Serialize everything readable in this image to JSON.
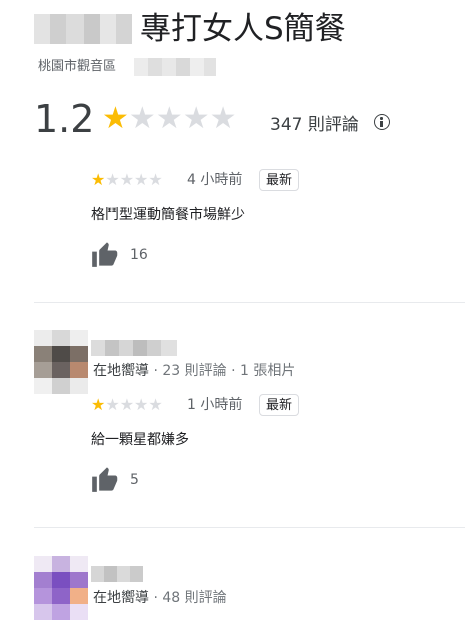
{
  "place": {
    "title": "專打女人S簡餐",
    "address": "桃園市觀音區",
    "rating": "1.2",
    "rating_value": 1.2,
    "stars_total": 5,
    "review_count": "347 則評論"
  },
  "reviews": [
    {
      "stars": 1,
      "time": "4 小時前",
      "badge": "最新",
      "text": "格鬥型運動簡餐市場鮮少",
      "likes": "16"
    },
    {
      "reviewer_meta": "在地嚮導",
      "reviewer_stats": " · 23 則評論 · 1 張相片",
      "stars": 1,
      "time": "1 小時前",
      "badge": "最新",
      "text": "給一顆星都嫌多",
      "likes": "5"
    },
    {
      "reviewer_meta": "在地嚮導",
      "reviewer_stats": " · 48 則評論"
    }
  ],
  "colors": {
    "star_on": "#fbbc04",
    "star_off": "#dadce0",
    "text": "#202124",
    "secondary": "#5f6368"
  }
}
